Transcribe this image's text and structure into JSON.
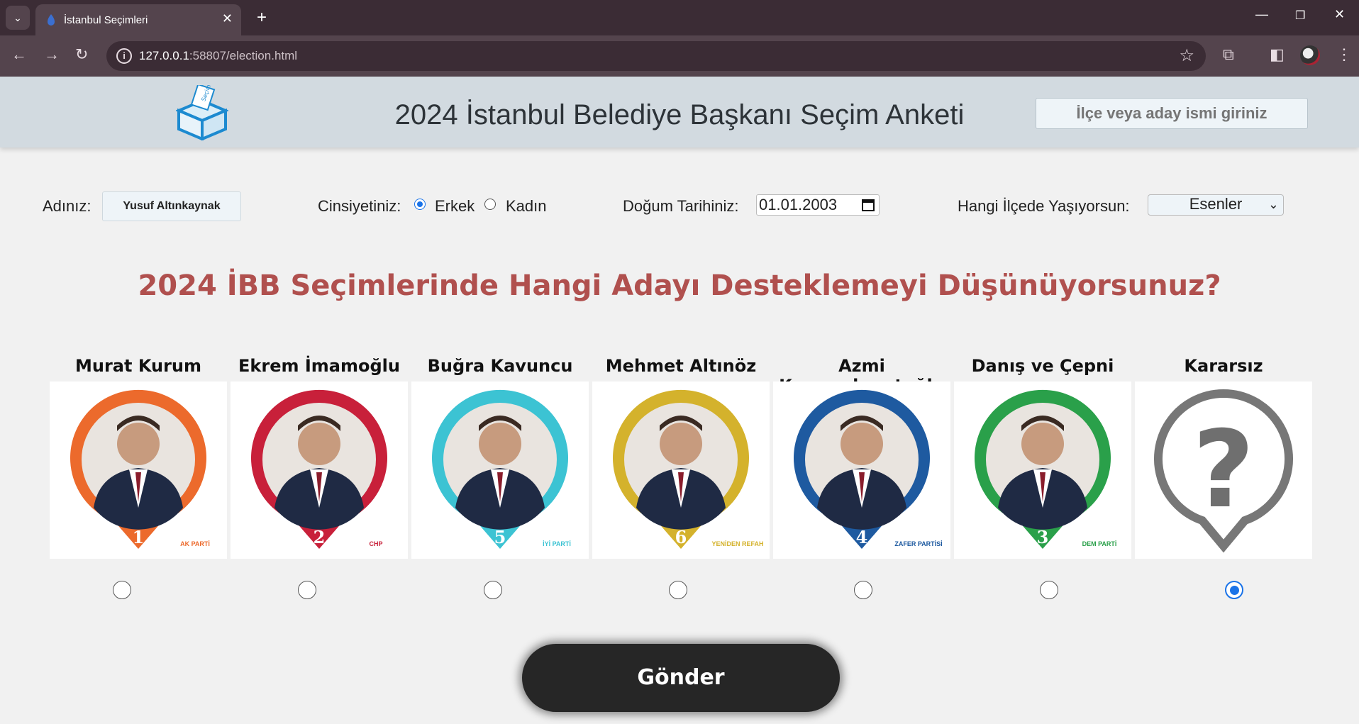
{
  "browser": {
    "tab_title": "İstanbul Seçimleri",
    "url_host": "127.0.0.1",
    "url_rest": ":58807/election.html"
  },
  "header": {
    "title": "2024 İstanbul Belediye Başkanı Seçim Anketi",
    "search_placeholder": "İlçe veya aday ismi giriniz",
    "logo_text": "Seçim"
  },
  "form": {
    "name_label": "Adınız:",
    "name_value": "Yusuf Altınkaynak",
    "gender_label": "Cinsiyetiniz:",
    "gender_options": [
      "Erkek",
      "Kadın"
    ],
    "gender_selected": "Erkek",
    "birth_label": "Doğum Tarihiniz:",
    "birth_value": "01.01.2003",
    "district_label": "Hangi İlçede Yaşıyorsun:",
    "district_value": "Esenler"
  },
  "question": "2024 İBB Seçimlerinde Hangi Adayı Desteklemeyi Düşünüyorsunuz?",
  "candidates": [
    {
      "name": "Murat Kurum",
      "number": "1",
      "party": "AK PARTİ",
      "color": "#ec6a2c",
      "selected": false
    },
    {
      "name": "Ekrem İmamoğlu",
      "number": "2",
      "party": "CHP",
      "color": "#c8203a",
      "selected": false
    },
    {
      "name": "Buğra Kavuncu",
      "number": "5",
      "party": "İYİ PARTİ",
      "color": "#3cc3d3",
      "selected": false
    },
    {
      "name": "Mehmet Altınöz",
      "number": "6",
      "party": "YENİDEN REFAH",
      "color": "#d4b22c",
      "selected": false
    },
    {
      "name": "Azmi Karamahmutoğlu",
      "number": "4",
      "party": "ZAFER PARTİSİ",
      "color": "#1e5aa0",
      "selected": false
    },
    {
      "name": "Danış ve Çepni",
      "number": "3",
      "party": "DEM PARTİ",
      "color": "#2aa04a",
      "selected": false
    },
    {
      "name": "Kararsız",
      "number": "?",
      "party": "",
      "color": "#7a7a7a",
      "selected": true
    }
  ],
  "submit_label": "Gönder"
}
